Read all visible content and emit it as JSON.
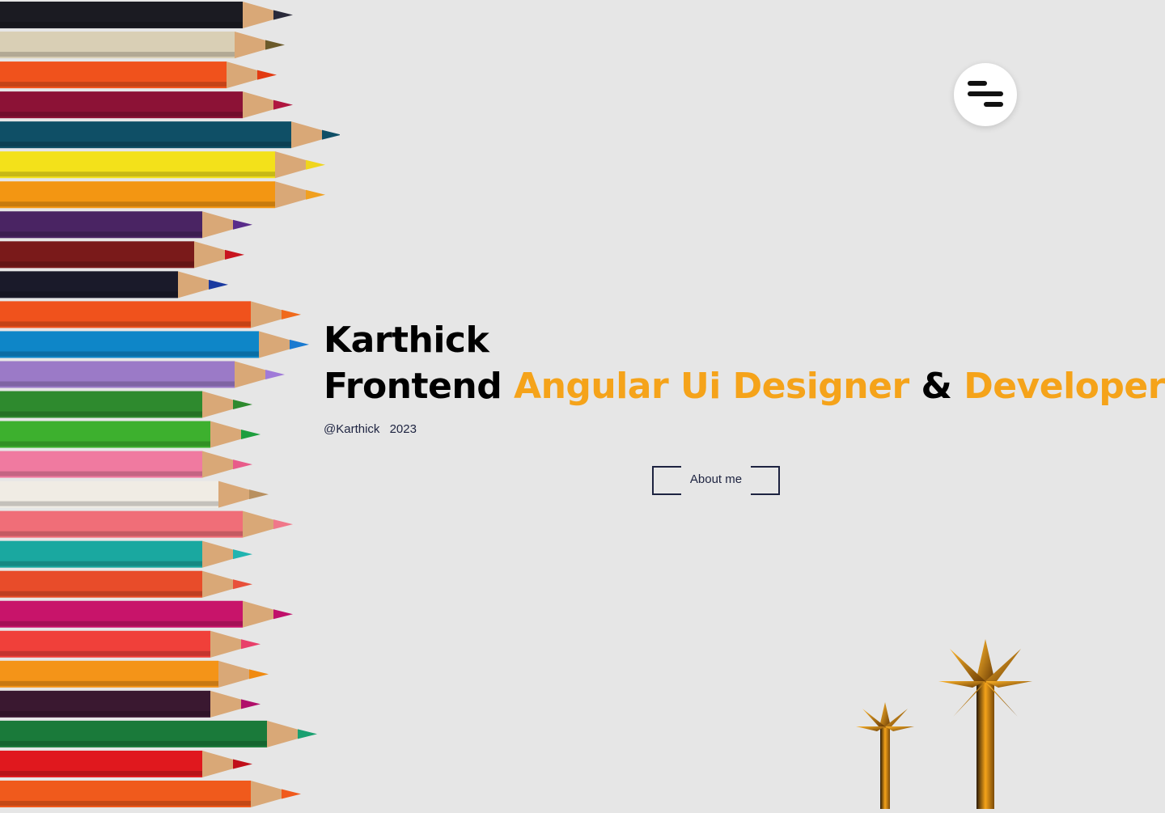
{
  "hero": {
    "name": "Karthick",
    "role_prefix": "Frontend",
    "role_accent_1": "Angular Ui Designer",
    "role_connector": "&",
    "role_accent_2": "Developer",
    "credit_handle": "@Karthick",
    "credit_year": "2023"
  },
  "cta": {
    "label": "About me"
  },
  "menu": {
    "icon": "menu-icon"
  },
  "colors": {
    "background": "#e6e6e6",
    "accent": "#f5a31a",
    "text": "#000000",
    "navy": "#1d2340"
  }
}
